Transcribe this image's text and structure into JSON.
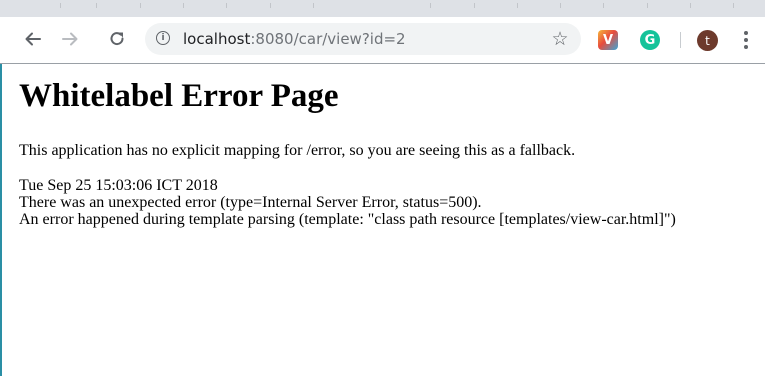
{
  "browser": {
    "url_host": "localhost",
    "url_rest": ":8080/car/view?id=2",
    "icons": {
      "back": "back-arrow-icon",
      "forward": "forward-arrow-icon",
      "reload": "reload-icon",
      "info": "info-icon",
      "bookmark": "star-icon",
      "extension_1": "v-extension-icon",
      "extension_2": "grammarly-icon",
      "menu": "kebab-menu-icon"
    },
    "extension_1_letter": "V",
    "extension_2_letter": "G",
    "avatar_letter": "t",
    "colors": {
      "toolbar": "#ffffff",
      "tabstrip": "#dee1e6",
      "omnibox": "#f1f3f4",
      "avatar": "#6d3a2c",
      "grammarly": "#15c39a"
    }
  },
  "page": {
    "title": "Whitelabel Error Page",
    "fallback_message": "This application has no explicit mapping for /error, so you are seeing this as a fallback.",
    "timestamp": "Tue Sep 25 15:03:06 ICT 2018",
    "error_line": "There was an unexpected error (type=Internal Server Error, status=500).",
    "detail_line": "An error happened during template parsing (template: \"class path resource [templates/view-car.html]\")"
  }
}
